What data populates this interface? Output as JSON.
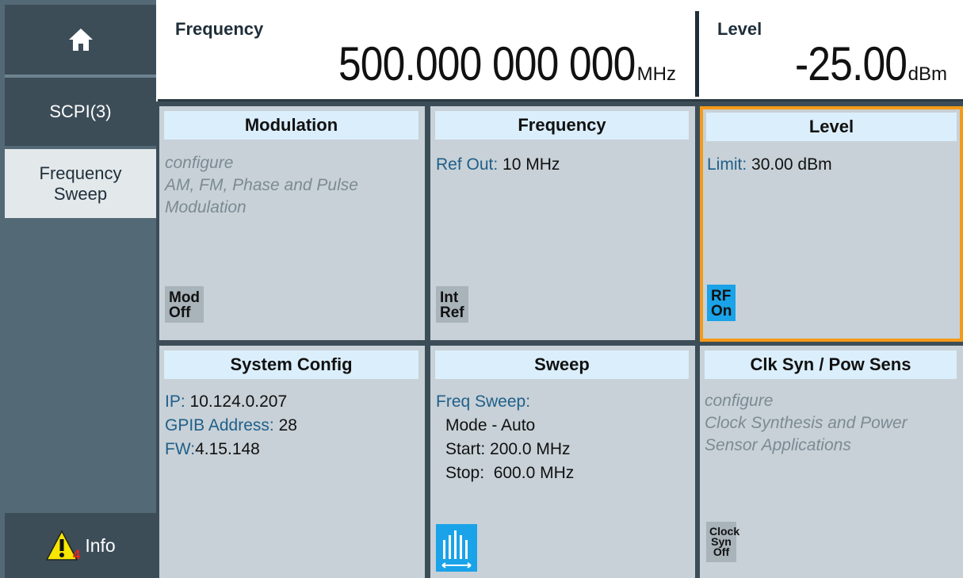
{
  "sidebar": {
    "home_icon": "home-icon",
    "scpi_label": "SCPI(3)",
    "sweep_label_line1": "Frequency",
    "sweep_label_line2": "Sweep",
    "info_label": "Info",
    "info_count": "4",
    "warning_icon": "warning-icon"
  },
  "header": {
    "frequency_label": "Frequency",
    "frequency_value": "500.000 000 000",
    "frequency_unit": "MHz",
    "level_label": "Level",
    "level_value": "-25.00",
    "level_unit": "dBm"
  },
  "tiles": {
    "modulation": {
      "title": "Modulation",
      "line1": "configure",
      "line2": "AM, FM, Phase and Pulse",
      "line3": "Modulation",
      "button_line1": "Mod",
      "button_line2": "Off"
    },
    "frequency": {
      "title": "Frequency",
      "ref_label": "Ref Out:",
      "ref_value": " 10 MHz",
      "button_line1": "Int",
      "button_line2": "Ref"
    },
    "level": {
      "title": "Level",
      "limit_label": "Limit:",
      "limit_value": " 30.00 dBm",
      "button_line1": "RF",
      "button_line2": "On"
    },
    "system_config": {
      "title": "System Config",
      "ip_label": "IP:",
      "ip_value": " 10.124.0.207",
      "gpib_label": "GPIB Address:",
      "gpib_value": " 28",
      "fw_label": "FW:",
      "fw_value": "4.15.148"
    },
    "sweep": {
      "title": "Sweep",
      "freq_sweep_label": "Freq Sweep:",
      "mode": "Mode - Auto",
      "start": "Start: 200.0 MHz",
      "stop": "Stop:  600.0 MHz",
      "icon": "sweep-icon"
    },
    "clk_syn": {
      "title": "Clk Syn / Pow Sens",
      "line1": "configure",
      "line2": "Clock Synthesis and Power",
      "line3": "Sensor Applications",
      "button_line1": "Clock",
      "button_line2": "Syn",
      "button_line3": "Off"
    }
  },
  "colors": {
    "accent_orange": "#f39a18",
    "rf_on_blue": "#1aa3e8",
    "title_bg": "#dbeefb",
    "tile_bg": "#c8d1d7",
    "sidebar_dark": "#3c4d58"
  }
}
